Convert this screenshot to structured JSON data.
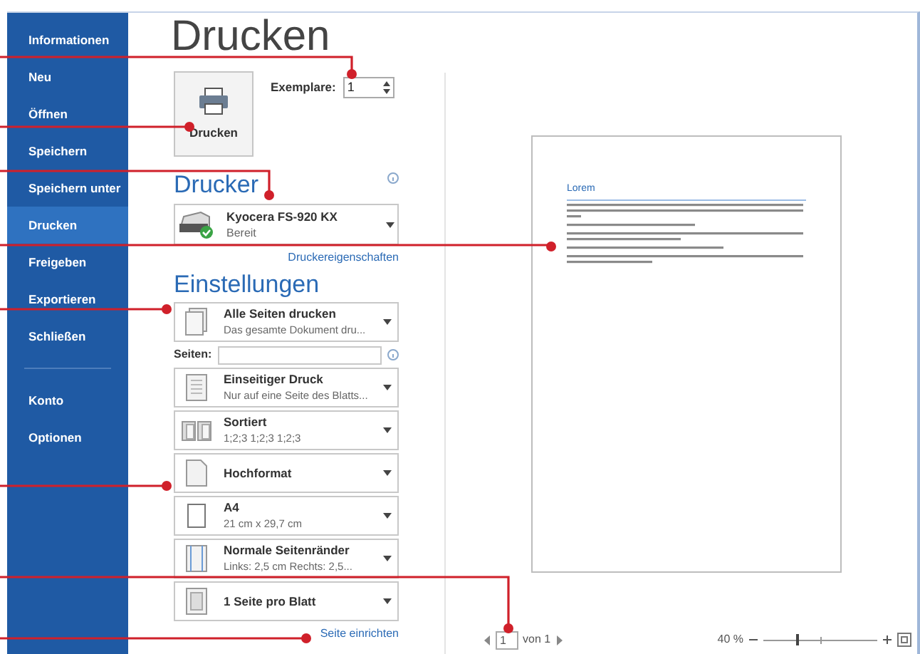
{
  "title": "Drucken",
  "sidebar": {
    "items": [
      {
        "label": "Informationen",
        "selected": false
      },
      {
        "label": "Neu",
        "selected": false
      },
      {
        "label": "Öffnen",
        "selected": false
      },
      {
        "label": "Speichern",
        "selected": false
      },
      {
        "label": "Speichern unter",
        "selected": false
      },
      {
        "label": "Drucken",
        "selected": true
      },
      {
        "label": "Freigeben",
        "selected": false
      },
      {
        "label": "Exportieren",
        "selected": false
      },
      {
        "label": "Schließen",
        "selected": false
      }
    ],
    "footer_items": [
      {
        "label": "Konto",
        "selected": false
      },
      {
        "label": "Optionen",
        "selected": false
      }
    ]
  },
  "print_button": {
    "label": "Drucken"
  },
  "copies": {
    "label": "Exemplare:",
    "value": "1"
  },
  "printer": {
    "heading": "Drucker",
    "name": "Kyocera FS-920 KX",
    "status": "Bereit",
    "properties_link": "Druckereigenschaften"
  },
  "settings": {
    "heading": "Einstellungen",
    "pages_label": "Seiten:",
    "options": [
      {
        "kind": "pages",
        "title": "Alle Seiten drucken",
        "subtitle": "Das gesamte Dokument dru..."
      },
      {
        "kind": "duplex",
        "title": "Einseitiger Druck",
        "subtitle": "Nur auf eine Seite des Blatts..."
      },
      {
        "kind": "collate",
        "title": "Sortiert",
        "subtitle": "1;2;3 1;2;3 1;2;3"
      },
      {
        "kind": "portrait",
        "title": "Hochformat"
      },
      {
        "kind": "paper",
        "title": "A4",
        "subtitle": "21 cm x 29,7 cm"
      },
      {
        "kind": "margins",
        "title": "Normale Seitenränder",
        "subtitle": "Links: 2,5 cm Rechts: 2,5..."
      },
      {
        "kind": "persheet",
        "title": "1 Seite pro Blatt"
      }
    ],
    "setup_link": "Seite einrichten"
  },
  "preview": {
    "doc_heading": "Lorem"
  },
  "pager": {
    "page": "1",
    "of": "von 1"
  },
  "zoom": {
    "label": "40 %",
    "level": 0.3
  }
}
